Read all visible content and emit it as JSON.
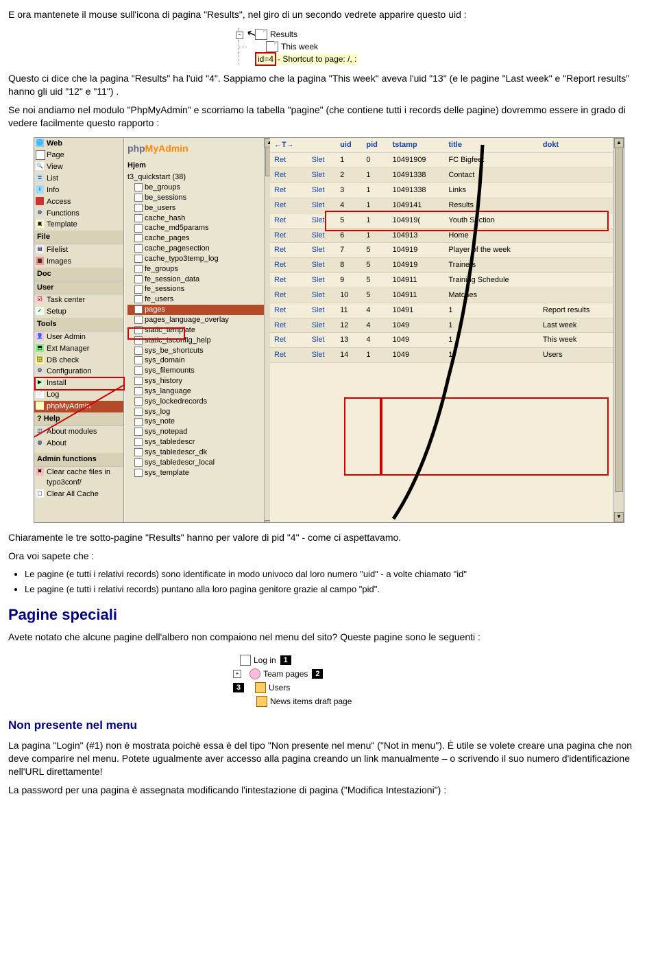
{
  "p1": "E ora mantenete il mouse sull'icona di pagina \"Results\", nel giro di un secondo vedrete apparire questo uid :",
  "fig1": {
    "results": "Results",
    "thisweek": "This week",
    "idlabel": "id=4",
    "shortcut": "- Shortcut to page: /, :"
  },
  "p2": "Questo ci dice che la pagina \"Results\" ha l'uid \"4\". Sappiamo che la pagina \"This week\" aveva l'uid \"13\" (e le pagine \"Last week\" e \"Report results\" hanno gli uid  \"12\" e \"11\") .",
  "p3": "Se noi andiamo nel modulo \"PhpMyAdmin\" e scorriamo la tabella \"pagine\" (che contiene tutti i records delle pagine) dovremmo essere in grado di vedere  facilmente questo rapporto :",
  "nav": {
    "web": "Web",
    "items_web": [
      "Page",
      "View",
      "List",
      "Info",
      "Access",
      "Functions",
      "Template"
    ],
    "file": "File",
    "items_file": [
      "Filelist",
      "Images"
    ],
    "doc": "Doc",
    "user": "User",
    "items_user": [
      "Task center",
      "Setup"
    ],
    "tools": "Tools",
    "items_tools": [
      "User Admin",
      "Ext Manager",
      "DB check",
      "Configuration",
      "Install",
      "Log",
      "phpMyAdmin"
    ],
    "help": "Help",
    "items_help": [
      "About modules",
      "About"
    ],
    "adminfn": "Admin functions",
    "clearcache": "Clear cache files in typo3conf/",
    "clearall": "Clear All Cache"
  },
  "tree": {
    "logo1": "php",
    "logo2": "MyAdmin",
    "home": "Hjem",
    "db": "t3_quickstart  (38)",
    "tables": [
      "be_groups",
      "be_sessions",
      "be_users",
      "cache_hash",
      "cache_md5params",
      "cache_pages",
      "cache_pagesection",
      "cache_typo3temp_log",
      "fe_groups",
      "fe_session_data",
      "fe_sessions",
      "fe_users",
      "pages",
      "pages_language_overlay",
      "static_template",
      "static_tsconfig_help",
      "sys_be_shortcuts",
      "sys_domain",
      "sys_filemounts",
      "sys_history",
      "sys_language",
      "sys_lockedrecords",
      "sys_log",
      "sys_note",
      "sys_notepad",
      "sys_tabledescr",
      "sys_tabledescr_dk",
      "sys_tabledescr_local",
      "sys_template"
    ]
  },
  "table": {
    "arrow": "←T→",
    "headers": [
      "uid",
      "pid",
      "tstamp",
      "title",
      "dokt"
    ],
    "ret": "Ret",
    "slet": "Slet",
    "rows": [
      {
        "uid": "1",
        "pid": "0",
        "ts": "10491909",
        "title": "FC Bigfeet"
      },
      {
        "uid": "2",
        "pid": "1",
        "ts": "10491338",
        "title": "Contact"
      },
      {
        "uid": "3",
        "pid": "1",
        "ts": "10491338",
        "title": "Links"
      },
      {
        "uid": "4",
        "pid": "1",
        "ts": "1049141",
        "title": "Results"
      },
      {
        "uid": "5",
        "pid": "1",
        "ts": "104919(",
        "title": "Youth Section"
      },
      {
        "uid": "6",
        "pid": "1",
        "ts": "104913",
        "title": "Home"
      },
      {
        "uid": "7",
        "pid": "5",
        "ts": "104919",
        "title": "Player of the week"
      },
      {
        "uid": "8",
        "pid": "5",
        "ts": "104919",
        "title": "Trainers"
      },
      {
        "uid": "9",
        "pid": "5",
        "ts": "104911",
        "title": "Training Schedule"
      },
      {
        "uid": "10",
        "pid": "5",
        "ts": "104911",
        "title": "Matches"
      },
      {
        "uid": "11",
        "pid": "4",
        "ts": "10491",
        "title": "Report results"
      },
      {
        "uid": "12",
        "pid": "4",
        "ts": "1049",
        "title": "Last week"
      },
      {
        "uid": "13",
        "pid": "4",
        "ts": "1049",
        "title": "This week"
      },
      {
        "uid": "14",
        "pid": "1",
        "ts": "1049",
        "title": "Users"
      }
    ],
    "extra": [
      "1",
      "1",
      "1",
      "1"
    ]
  },
  "p4": "Chiaramente le tre sotto-pagine \"Results\" hanno per valore di pid  \"4\" - come ci aspettavamo.",
  "p5": "Ora voi sapete che :",
  "bul1": "Le pagine (e tutti i relativi records) sono identificate in modo univoco dal loro numero \"uid\" - a volte chiamato \"id\"",
  "bul2": "Le pagine (e tutti i relativi records) puntano alla loro pagina genitore grazie al campo \"pid\".",
  "h2": "Pagine speciali",
  "p6": "Avete notato che alcune pagine dell'albero non compaiono nel menu del sito? Queste pagine sono le seguenti :",
  "fig3": {
    "login": "Log in",
    "team": "Team pages",
    "users": "Users",
    "news": "News items draft page",
    "b1": "1",
    "b2": "2",
    "b3": "3"
  },
  "h3": "Non presente nel menu",
  "p7": "La pagina \"Login\" (#1) non è mostrata poichè essa è del tipo \"Non presente nel menu\" (\"Not in menu\"). È utile se volete creare una pagina che non deve comparire nel menu. Potete ugualmente aver accesso alla pagina creando un link manualmente – o scrivendo il suo numero d'identificazione nell'URL direttamente!",
  "p8": "La password per una pagina è assegnata modificando l'intestazione di pagina (\"Modifica Intestazioni\") :"
}
